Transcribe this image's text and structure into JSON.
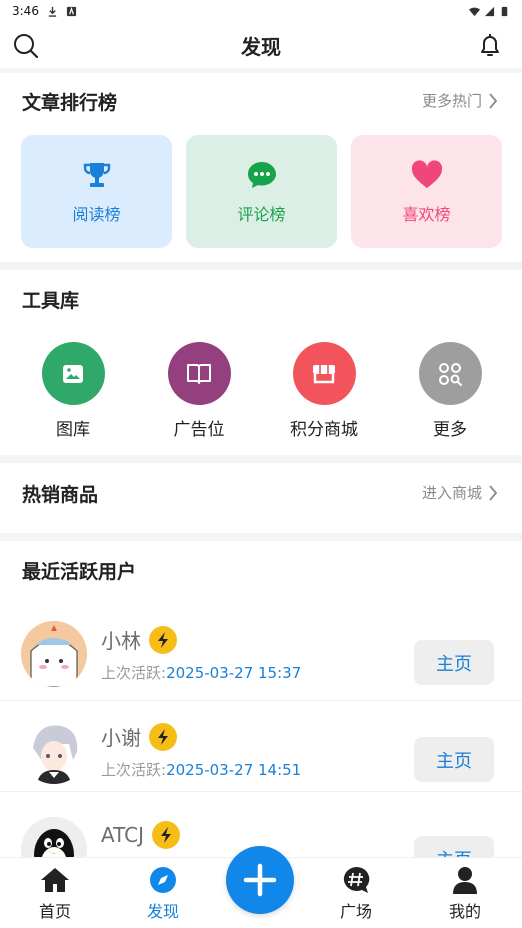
{
  "status_bar": {
    "time": "3:46"
  },
  "header": {
    "title": "发现"
  },
  "rankings": {
    "title": "文章排行榜",
    "more_label": "更多热门",
    "cards": [
      {
        "label": "阅读榜",
        "icon": "trophy-icon",
        "bg": "#dcecff",
        "color": "#1a7fd6"
      },
      {
        "label": "评论榜",
        "icon": "chat-bubble-icon",
        "bg": "#dcefe6",
        "color": "#16a34a"
      },
      {
        "label": "喜欢榜",
        "icon": "heart-icon",
        "bg": "#fde3ea",
        "color": "#f0467a"
      }
    ]
  },
  "tools": {
    "title": "工具库",
    "items": [
      {
        "label": "图库",
        "icon": "image-icon",
        "color": "#2fa86a"
      },
      {
        "label": "广告位",
        "icon": "book-icon",
        "color": "#94407e"
      },
      {
        "label": "积分商城",
        "icon": "store-icon",
        "color": "#f2545b"
      },
      {
        "label": "更多",
        "icon": "grid-search-icon",
        "color": "#9e9e9e"
      }
    ]
  },
  "hot_products": {
    "title": "热销商品",
    "more_label": "进入商城"
  },
  "active_users": {
    "title": "最近活跃用户",
    "active_prefix": "上次活跃:",
    "home_label": "主页",
    "users": [
      {
        "name": "小林",
        "last_active": "2025-03-27 15:37"
      },
      {
        "name": "小谢",
        "last_active": "2025-03-27 14:51"
      },
      {
        "name": "ATCJ",
        "last_active": ""
      }
    ]
  },
  "bottom_nav": {
    "items": [
      {
        "label": "首页",
        "icon": "home-icon"
      },
      {
        "label": "发现",
        "icon": "compass-icon"
      },
      {
        "label": "广场",
        "icon": "hashtag-bubble-icon"
      },
      {
        "label": "我的",
        "icon": "user-icon"
      }
    ],
    "active": "发现",
    "accent": "#1187ea"
  }
}
